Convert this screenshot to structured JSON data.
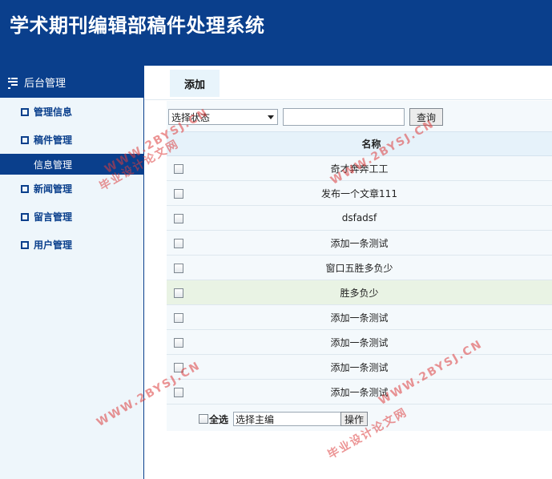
{
  "header": {
    "title": "学术期刊编辑部稿件处理系统"
  },
  "sidebar": {
    "heading": "后台管理",
    "items": [
      {
        "label": "管理信息"
      },
      {
        "label": "稿件管理"
      },
      {
        "label": "信息管理"
      },
      {
        "label": "新闻管理"
      },
      {
        "label": "留言管理"
      },
      {
        "label": "用户管理"
      }
    ]
  },
  "tabs": {
    "add_label": "添加"
  },
  "filters": {
    "status_select": "选择状态",
    "query_button": "查询"
  },
  "table": {
    "header": "名称",
    "rows": [
      "奇才奔奔工工",
      "发布一个文章111",
      "dsfadsf",
      "添加一条测试",
      "窗口五胜多负少",
      "胜多负少",
      "添加一条测试",
      "添加一条测试",
      "添加一条测试",
      "添加一条测试"
    ]
  },
  "footer": {
    "select_all": "全选",
    "editor_select": "选择主编",
    "action_button": "操作"
  },
  "watermarks": {
    "site": "WWW.2BYSJ.CN",
    "brand": "毕业设计论文网"
  },
  "colors": {
    "brand_blue": "#0a3f8c",
    "highlight_row": "#e9f3e4",
    "watermark": "#dc3c3c"
  }
}
